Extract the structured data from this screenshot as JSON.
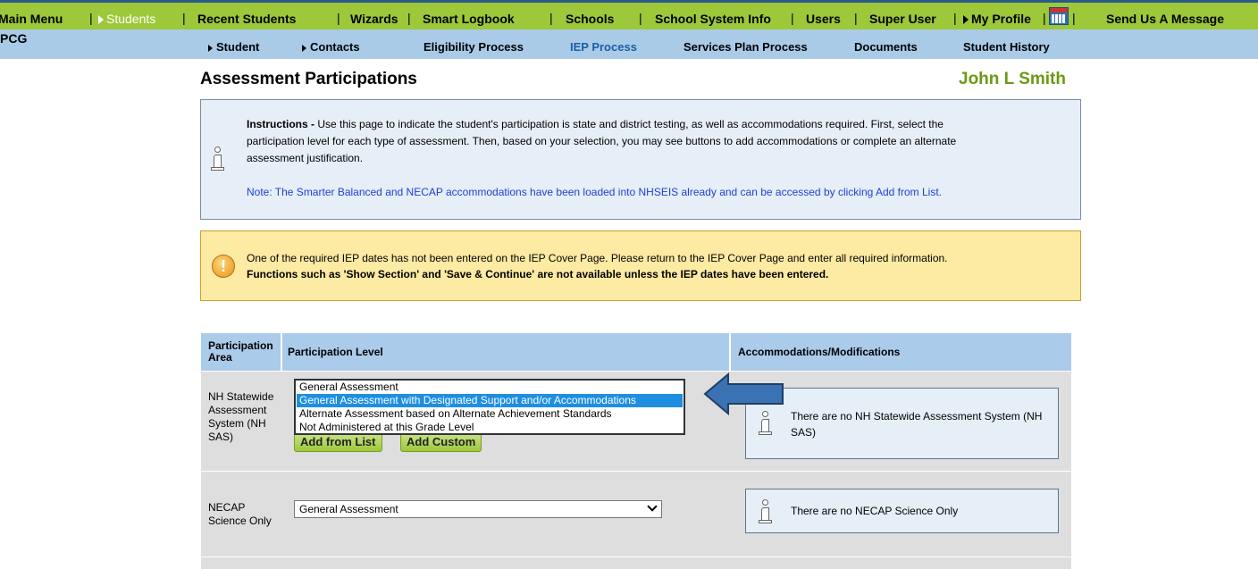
{
  "topnav": {
    "items": [
      {
        "label": "Main Menu",
        "active": false
      },
      {
        "label": "Students",
        "active": true
      },
      {
        "label": "Recent Students",
        "active": false
      },
      {
        "label": "Wizards",
        "active": false
      },
      {
        "label": "Smart Logbook",
        "active": false
      },
      {
        "label": "Schools",
        "active": false
      },
      {
        "label": "School System Info",
        "active": false
      },
      {
        "label": "Users",
        "active": false
      },
      {
        "label": "Super User",
        "active": false
      },
      {
        "label": "My Profile",
        "active": false
      },
      {
        "label": "Send Us A Message",
        "active": false
      }
    ],
    "separator": "|",
    "calendar_icon": "calendar-icon"
  },
  "subnav": {
    "brand": "PCG",
    "items": [
      {
        "label": "Student",
        "active": false
      },
      {
        "label": "Contacts",
        "active": false
      },
      {
        "label": "Eligibility Process",
        "active": false
      },
      {
        "label": "IEP Process",
        "active": true
      },
      {
        "label": "Services Plan Process",
        "active": false
      },
      {
        "label": "Documents",
        "active": false
      },
      {
        "label": "Student History",
        "active": false
      }
    ]
  },
  "page": {
    "title": "Assessment Participations",
    "student_name": "John L Smith"
  },
  "instructions": {
    "lead": "Instructions - ",
    "line1": "Use this page to indicate the student's participation is state and district testing, as well as accommodations required. First, select the",
    "line2": "participation level for each type of assessment. Then, based on your selection, you may see buttons to add accommodations or complete an alternate",
    "line3": "assessment justification.",
    "note": "Note: The Smarter Balanced and NECAP accommodations have been loaded into NHSEIS already and can be accessed by clicking Add from List."
  },
  "warning": {
    "line1": "One of the required IEP dates has not been entered on the IEP Cover Page. Please return to the IEP Cover Page and enter all required information.",
    "line2": "Functions such as 'Show Section' and 'Save & Continue' are not available unless the IEP dates have been entered."
  },
  "table": {
    "headers": {
      "area": "Participation Area",
      "level": "Participation Level",
      "accommodations": "Accommodations/Modifications"
    },
    "rows": [
      {
        "area": "NH Statewide Assessment System (NH SAS)",
        "options": [
          "General Assessment",
          "General Assessment with Designated Support and/or Accommodations",
          "Alternate Assessment based on Alternate Achievement Standards",
          "Not Administered at this Grade Level"
        ],
        "highlighted_option": "General Assessment with Designated Support and/or Accommodations",
        "buttons": [
          "Add from List",
          "Add Custom"
        ],
        "accommodations_text": "There are no NH Statewide Assessment System (NH SAS)"
      },
      {
        "area": "NECAP Science Only",
        "selected": "General Assessment",
        "accommodations_text": "There are no NECAP Science Only"
      }
    ]
  },
  "colors": {
    "topnav_bg": "#9cc83a",
    "subnav_bg": "#a9cbe8",
    "student_name": "#6a9a14",
    "active_tab": "#1c5fa3",
    "highlight": "#1e8fe0",
    "arrow": "#3b72b3"
  }
}
